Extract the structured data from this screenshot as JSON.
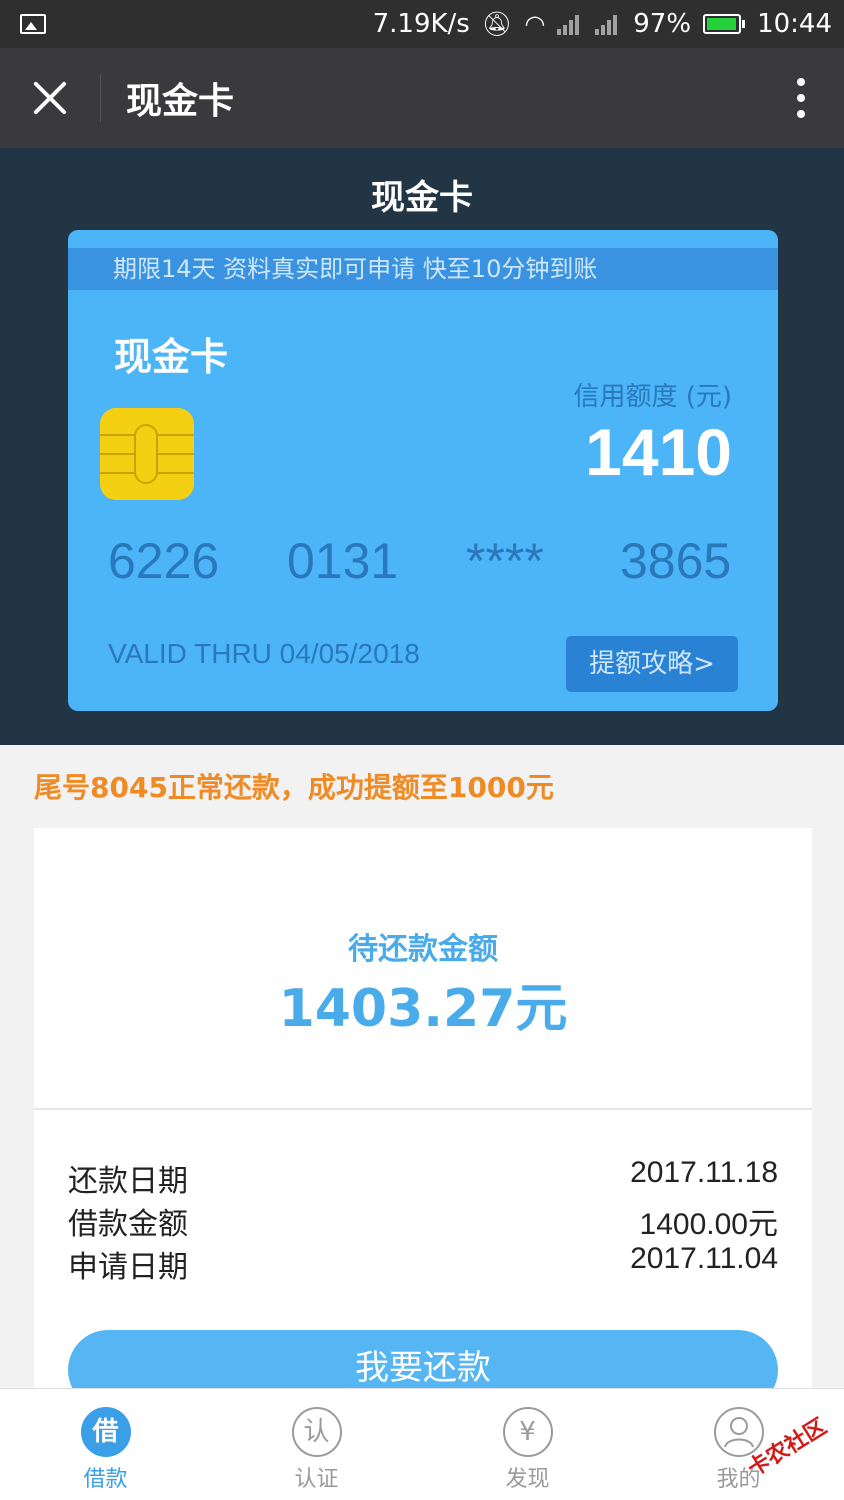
{
  "status_bar": {
    "speed": "7.19K/s",
    "battery_percent": "97%",
    "time": "10:44",
    "battery_level": 0.97,
    "battery_color": "#25d13a"
  },
  "title_bar": {
    "title": "现金卡"
  },
  "hero": {
    "page_title": "现金卡"
  },
  "card": {
    "notice": "期限14天 资料真实即可申请 快至10分钟到账",
    "name": "现金卡",
    "credit_label": "信用额度 (元)",
    "credit_value": "1410",
    "number_groups": [
      "6226",
      "0131",
      "****",
      "3865"
    ],
    "valid_thru": "VALID THRU 04/05/2018",
    "limit_button": "提额攻略>"
  },
  "promo": "尾号8045正常还款，成功提额至1000元",
  "repayment": {
    "due_label": "待还款金额",
    "due_value": "1403.27元",
    "rows": [
      {
        "label": "还款日期",
        "value": "2017.11.18"
      },
      {
        "label": "借款金额",
        "value": "1400.00元"
      },
      {
        "label": "申请日期",
        "value": "2017.11.04"
      }
    ],
    "repay_button": "我要还款"
  },
  "tabbar": {
    "items": [
      {
        "icon_char": "借",
        "label": "借款",
        "active": true
      },
      {
        "icon_char": "认",
        "label": "认证",
        "active": false
      },
      {
        "icon_char": "¥",
        "label": "发现",
        "active": false
      },
      {
        "icon_char": "",
        "label": "我的",
        "active": false
      }
    ]
  },
  "watermark": "卡农社区"
}
